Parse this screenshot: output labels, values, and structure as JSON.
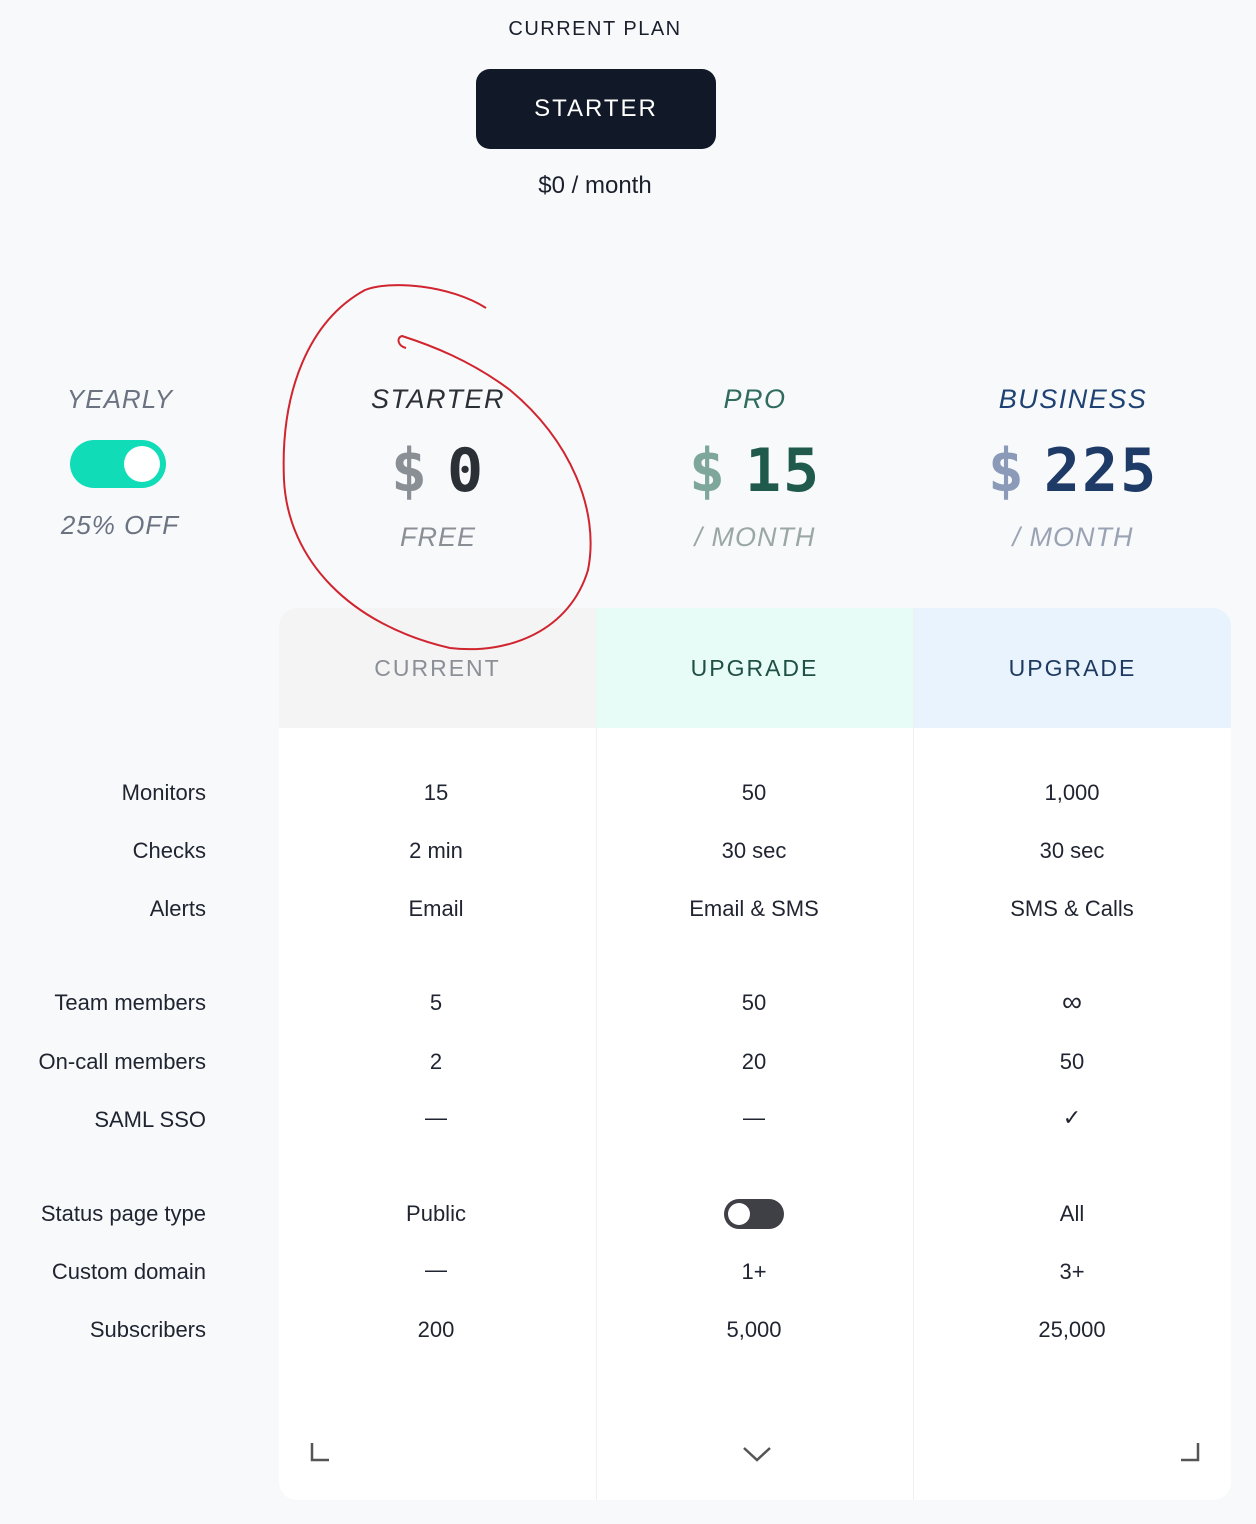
{
  "current_plan": {
    "label": "CURRENT PLAN",
    "plan": "STARTER",
    "price": "$0 / month"
  },
  "billing": {
    "label": "YEARLY",
    "toggle_on": true,
    "discount": "25% OFF",
    "toggle_color": "#10dcb7"
  },
  "plans": [
    {
      "name": "STARTER",
      "currency": "$",
      "amount": "0",
      "period": "FREE",
      "cta": "CURRENT",
      "name_color": "#2b2f36",
      "price_color": "#2b2f36",
      "currency_color": "#8a8f96",
      "period_color": "#8a8f96",
      "cta_color": "#8b8f96",
      "cta_bg": "#f4f4f5"
    },
    {
      "name": "PRO",
      "currency": "$",
      "amount": "15",
      "period": "/ MONTH",
      "cta": "UPGRADE",
      "name_color": "#2f6b5e",
      "price_color": "#1f5a4d",
      "currency_color": "#7fa69b",
      "period_color": "#9aa7a3",
      "cta_color": "#1f4f45",
      "cta_bg": "#e7fbf7"
    },
    {
      "name": "BUSINESS",
      "currency": "$",
      "amount": "225",
      "period": "/ MONTH",
      "cta": "UPGRADE",
      "name_color": "#1e4273",
      "price_color": "#1e3a66",
      "currency_color": "#8a9ab8",
      "period_color": "#9aa3b3",
      "cta_color": "#1e3a5f",
      "cta_bg": "#e8f3fe"
    }
  ],
  "features": [
    {
      "label": "Monitors",
      "values": [
        "15",
        "50",
        "1,000"
      ]
    },
    {
      "label": "Checks",
      "values": [
        "2 min",
        "30 sec",
        "30 sec"
      ]
    },
    {
      "label": "Alerts",
      "values": [
        "Email",
        "Email & SMS",
        "SMS & Calls"
      ]
    },
    {
      "label": "Team members",
      "values": [
        "5",
        "50",
        "∞"
      ]
    },
    {
      "label": "On-call members",
      "values": [
        "2",
        "20",
        "50"
      ]
    },
    {
      "label": "SAML SSO",
      "values": [
        "—",
        "—",
        "✓"
      ]
    },
    {
      "label": "Status page type",
      "values": [
        "Public",
        "",
        "All"
      ]
    },
    {
      "label": "Custom domain",
      "values": [
        "—",
        "1+",
        "3+"
      ]
    },
    {
      "label": "Subscribers",
      "values": [
        "200",
        "5,000",
        "25,000"
      ]
    }
  ],
  "status_page_toggle_on": false,
  "icons": [
    "corner-bracket-left-icon",
    "chevron-down-icon",
    "corner-bracket-right-icon",
    "infinity-icon",
    "checkmark-icon",
    "dash-icon"
  ],
  "annotation_color": "#d0242e"
}
